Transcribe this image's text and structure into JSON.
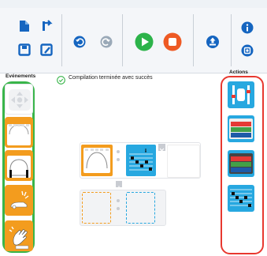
{
  "toolbar": {
    "icons": [
      "new-document-icon",
      "open-folder-icon",
      "save-icon",
      "save-as-icon",
      "undo-icon",
      "redo-icon",
      "run-icon",
      "stop-icon",
      "upload-robot-icon",
      "info-icon",
      "settings-icon"
    ]
  },
  "labels": {
    "events": "Evénements",
    "actions": "Actions"
  },
  "status": {
    "message": "Compilation terminée avec succès",
    "state": "success"
  },
  "events": [
    {
      "name": "buttons-event",
      "icon": "arrow-buttons-icon"
    },
    {
      "name": "front-proximity-event",
      "icon": "proximity-sensors-icon"
    },
    {
      "name": "ground-sensors-event",
      "icon": "ground-sensors-icon"
    },
    {
      "name": "tap-event",
      "icon": "tap-icon"
    },
    {
      "name": "clap-event",
      "icon": "clap-icon"
    }
  ],
  "actions": [
    {
      "name": "motors-action",
      "icon": "motors-icon"
    },
    {
      "name": "top-color-action",
      "icon": "top-color-icon"
    },
    {
      "name": "bottom-color-action",
      "icon": "bottom-color-icon"
    },
    {
      "name": "music-action",
      "icon": "music-notes-icon"
    }
  ],
  "colors": {
    "accent_orange": "#f39c1e",
    "action_blue": "#27a8e0",
    "events_border": "#39b54a",
    "actions_border": "#e8382f",
    "run": "#2cb34a",
    "stop": "#ee5a24",
    "toolbar_blue": "#1565c0"
  }
}
